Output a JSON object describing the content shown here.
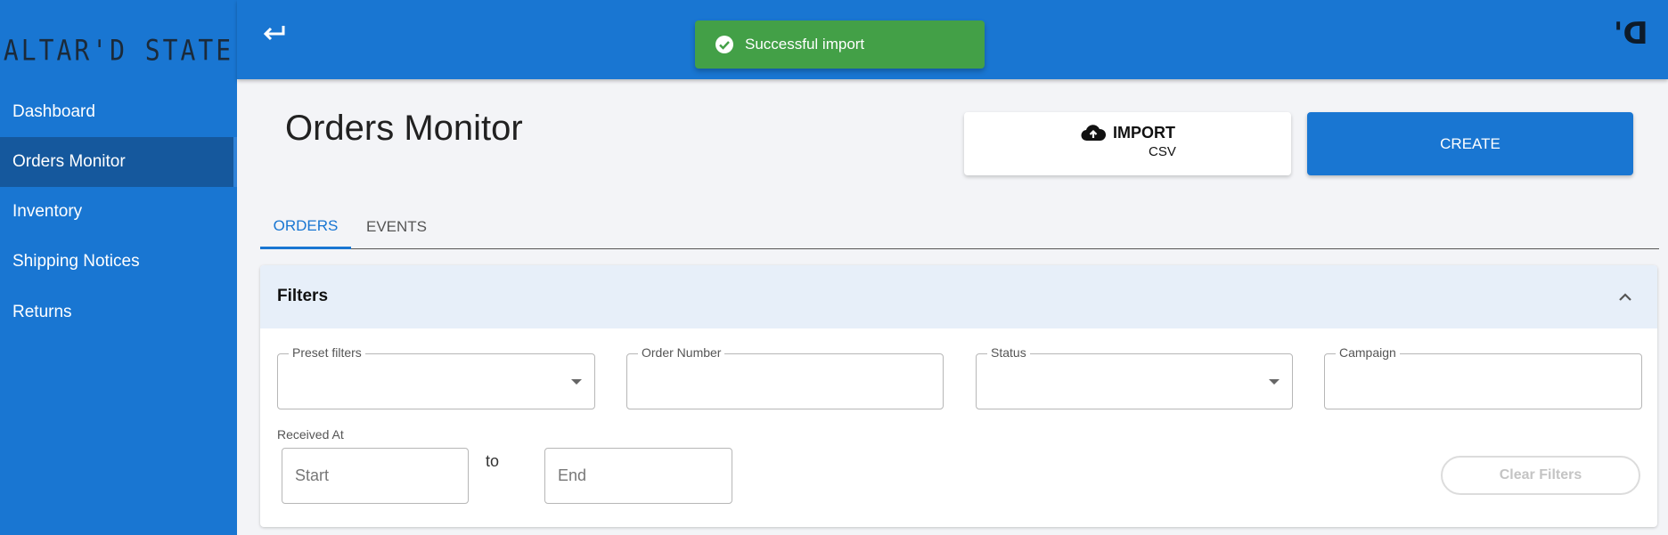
{
  "app": {
    "logo_text": "ALTAR'D STATE",
    "brand_mark": "D'"
  },
  "sidebar": {
    "items": [
      {
        "label": "Dashboard"
      },
      {
        "label": "Orders Monitor"
      },
      {
        "label": "Inventory"
      },
      {
        "label": "Shipping Notices"
      },
      {
        "label": "Returns"
      }
    ],
    "active_index": 1
  },
  "toast": {
    "message": "Successful import",
    "color": "#43a047"
  },
  "header": {
    "title": "Orders Monitor"
  },
  "actions": {
    "import_label": "IMPORT",
    "import_sub": "CSV",
    "create_label": "CREATE"
  },
  "tabs": [
    {
      "label": "ORDERS"
    },
    {
      "label": "EVENTS"
    }
  ],
  "filters": {
    "title": "Filters",
    "preset_label": "Preset filters",
    "preset_value": "",
    "order_number_label": "Order Number",
    "order_number_value": "",
    "status_label": "Status",
    "status_value": "",
    "campaign_label": "Campaign",
    "campaign_value": "",
    "received_label": "Received At",
    "start_placeholder": "Start",
    "to_text": "to",
    "end_placeholder": "End",
    "clear_label": "Clear Filters"
  },
  "colors": {
    "primary": "#1976d2",
    "sidebar_active": "#15589d",
    "success": "#43a047"
  }
}
